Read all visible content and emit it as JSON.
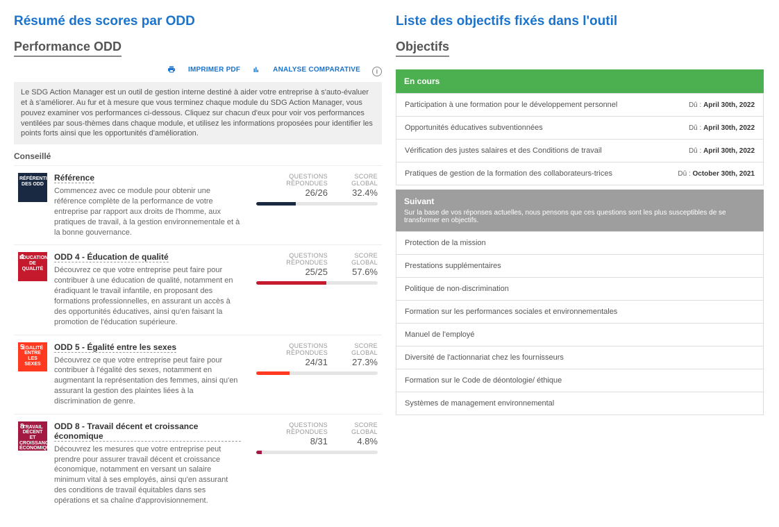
{
  "left": {
    "section_title": "Résumé des scores par ODD",
    "panel_heading": "Performance ODD",
    "actions": {
      "print": "IMPRIMER PDF",
      "compare": "ANALYSE COMPARATIVE"
    },
    "intro": "Le SDG Action Manager est un outil de gestion interne destiné à aider votre entreprise à s'auto-évaluer et à s'améliorer. Au fur et à mesure que vous terminez chaque module du SDG Action Manager, vous pouvez examiner vos performances ci-dessous. Cliquez sur chacun d'eux pour voir vos performances ventilées par sous-thèmes dans chaque module, et utilisez les informations proposées pour identifier les points forts ainsi que les opportunités d'amélioration.",
    "subhead": "Conseillé",
    "labels": {
      "questions": "QUESTIONS RÉPONDUES",
      "score": "SCORE GLOBAL"
    },
    "modules": [
      {
        "icon_class": "sdg-ref",
        "icon_num": "",
        "icon_label": "RÉFÉRENTIEL DES ODD",
        "title": "Référence",
        "desc": "Commencez avec ce module pour obtenir une référence complète de la performance de votre entreprise par rapport aux droits de l'homme, aux pratiques de travail, à la gestion environnementale et à la bonne gouvernance.",
        "q": "26/26",
        "score": "32.4%",
        "bar_pct": 32.4,
        "bar_color": "#1a2942"
      },
      {
        "icon_class": "sdg-4",
        "icon_num": "4",
        "icon_label": "ÉDUCATION DE QUALITÉ",
        "title": "ODD 4 - Éducation de qualité",
        "desc": "Découvrez ce que votre entreprise peut faire pour contribuer à une éducation de qualité, notamment en éradiquant le travail infantile, en proposant des formations professionnelles, en assurant un accès à des opportunités éducatives, ainsi qu'en faisant la promotion de l'éducation supérieure.",
        "q": "25/25",
        "score": "57.6%",
        "bar_pct": 57.6,
        "bar_color": "#c5192d"
      },
      {
        "icon_class": "sdg-5",
        "icon_num": "5",
        "icon_label": "ÉGALITÉ ENTRE LES SEXES",
        "title": "ODD 5 - Égalité entre les sexes",
        "desc": "Découvrez ce que votre entreprise peut faire pour contribuer à l'égalité des sexes, notamment en augmentant la représentation des femmes, ainsi qu'en assurant la gestion des plaintes liées à la discrimination de genre.",
        "q": "24/31",
        "score": "27.3%",
        "bar_pct": 27.3,
        "bar_color": "#ff3a21"
      },
      {
        "icon_class": "sdg-8",
        "icon_num": "8",
        "icon_label": "TRAVAIL DÉCENT ET CROISSANCE ÉCONOMIQUE",
        "title": "ODD 8 - Travail décent et croissance économique",
        "desc": "Découvrez les mesures que votre entreprise peut prendre pour assurer travail décent et croissance économique, notamment en versant un salaire minimum vital à ses employés, ainsi qu'en assurant des conditions de travail équitables dans ses opérations et sa chaîne d'approvisionnement.",
        "q": "8/31",
        "score": "4.8%",
        "bar_pct": 4.8,
        "bar_color": "#a21942"
      }
    ]
  },
  "right": {
    "section_title": "Liste des objectifs fixés dans l'outil",
    "panel_heading": "Objectifs",
    "in_progress": {
      "header": "En cours",
      "due_prefix": "Dû : ",
      "items": [
        {
          "label": "Participation à une formation pour le développement personnel",
          "due": "April 30th, 2022"
        },
        {
          "label": "Opportunités éducatives subventionnées",
          "due": "April 30th, 2022"
        },
        {
          "label": "Vérification des justes salaires et des Conditions de travail",
          "due": "April 30th, 2022"
        },
        {
          "label": "Pratiques de gestion de la formation des collaborateurs-trices",
          "due": "October 30th, 2021"
        }
      ]
    },
    "next": {
      "header": "Suivant",
      "sub": "Sur la base de vos réponses actuelles, nous pensons que ces questions sont les plus susceptibles de se transformer en objectifs.",
      "items": [
        {
          "label": "Protection de la mission"
        },
        {
          "label": "Prestations supplémentaires"
        },
        {
          "label": "Politique de non-discrimination"
        },
        {
          "label": "Formation sur les performances sociales et environnementales"
        },
        {
          "label": "Manuel de l'employé"
        },
        {
          "label": "Diversité de l'actionnariat chez les fournisseurs"
        },
        {
          "label": "Formation sur le Code de déontologie/ éthique"
        },
        {
          "label": "Systèmes de management environnemental"
        }
      ]
    }
  }
}
